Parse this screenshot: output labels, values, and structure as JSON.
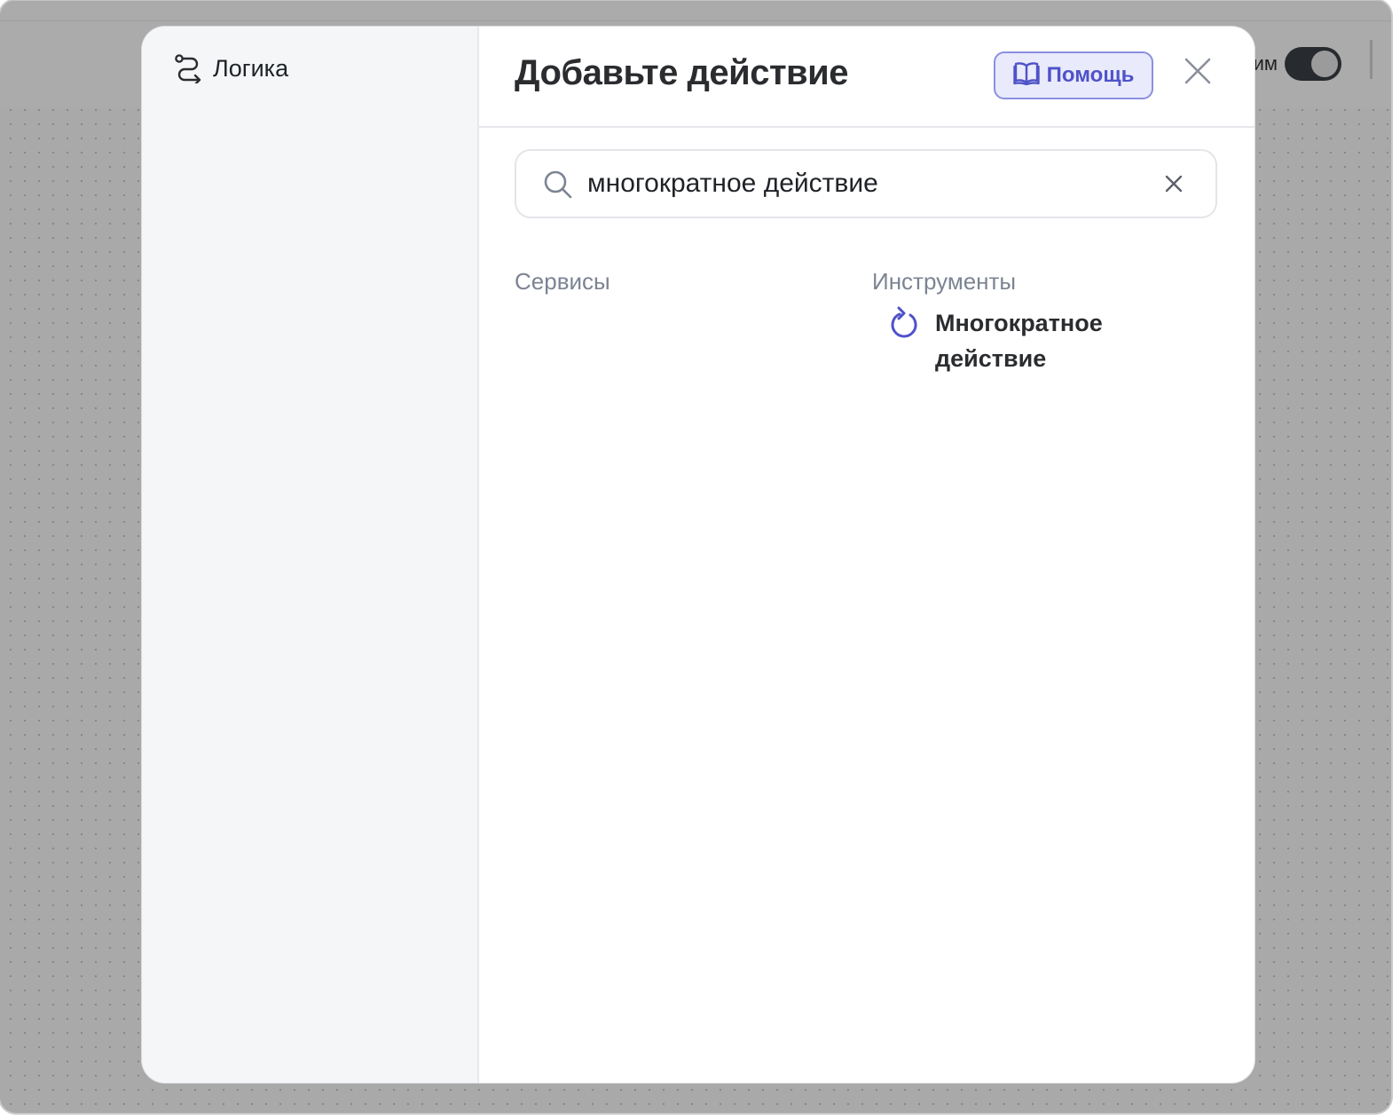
{
  "header": {
    "toggle_label_partial": "им"
  },
  "sidebar": {
    "items": [
      {
        "label": "Логика",
        "icon": "route-icon"
      }
    ]
  },
  "modal": {
    "title": "Добавьте действие",
    "help_button_label": "Помощь",
    "help_icon": "book-open-icon",
    "close_icon": "close-icon"
  },
  "search": {
    "value": "многократное действие",
    "icon": "search-icon",
    "clear_icon": "clear-icon"
  },
  "columns": {
    "services": {
      "heading": "Сервисы",
      "items": []
    },
    "tools": {
      "heading": "Инструменты",
      "items": [
        {
          "label": "Многократное действие",
          "icon": "repeat-icon"
        }
      ]
    }
  },
  "colors": {
    "accent": "#4f52c8",
    "accent_bg": "#e9eafb",
    "overlay": "#a9a9a9",
    "sidebar_bg": "#f5f6f8"
  }
}
